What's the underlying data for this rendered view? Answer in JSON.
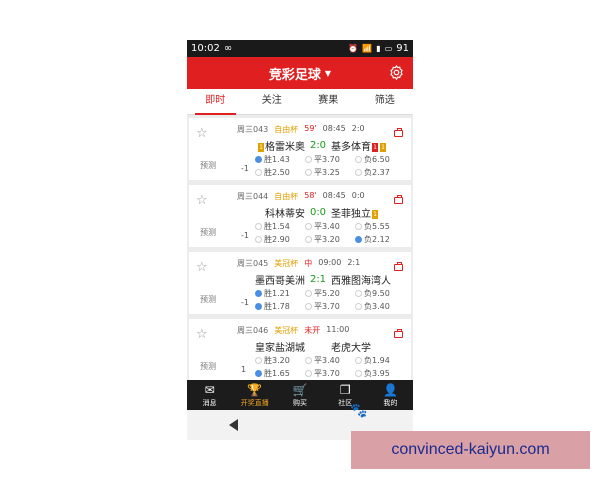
{
  "status_bar": {
    "time": "10:02",
    "infinity": "∞",
    "battery": "91"
  },
  "header": {
    "title": "竞彩足球"
  },
  "tabs": [
    {
      "label": "即时",
      "active": true
    },
    {
      "label": "关注",
      "active": false
    },
    {
      "label": "赛果",
      "active": false
    },
    {
      "label": "筛选",
      "active": false
    }
  ],
  "predict_label": "预测",
  "matches": [
    {
      "no": "周三043",
      "league": "自由杯",
      "league_color": "#e0a000",
      "minute": "59'",
      "time": "08:45",
      "half": "2:0",
      "home": "格雷米奥",
      "score": "2:0",
      "away": "基多体育",
      "home_badges": [
        {
          "t": "1",
          "c": "y"
        }
      ],
      "away_badges": [
        {
          "t": "1",
          "c": "r"
        },
        {
          "t": "1",
          "c": "y"
        }
      ],
      "handicap": "",
      "odds1": [
        "胜1.43",
        "平3.70",
        "负6.50"
      ],
      "sel1": 0,
      "handicap2": "-1",
      "odds2": [
        "胜2.50",
        "平3.25",
        "负2.37"
      ],
      "sel2": -1
    },
    {
      "no": "周三044",
      "league": "自由杯",
      "league_color": "#e0a000",
      "minute": "58'",
      "time": "08:45",
      "half": "0:0",
      "home": "科林蒂安",
      "score": "0:0",
      "away": "圣菲独立",
      "home_badges": [],
      "away_badges": [
        {
          "t": "1",
          "c": "y"
        }
      ],
      "odds1": [
        "胜1.54",
        "平3.40",
        "负5.55"
      ],
      "sel1": -1,
      "handicap2": "-1",
      "odds2": [
        "胜2.90",
        "平3.20",
        "负2.12"
      ],
      "sel2": 2
    },
    {
      "no": "周三045",
      "league": "美冠杯",
      "league_color": "#e0a000",
      "minute": "中",
      "time": "09:00",
      "half": "2:1",
      "home": "墨西哥美洲",
      "score": "2:1",
      "away": "西雅图海湾人",
      "home_badges": [],
      "away_badges": [],
      "odds1": [
        "胜1.21",
        "平5.20",
        "负9.50"
      ],
      "sel1": 0,
      "handicap2": "-1",
      "odds2": [
        "胜1.78",
        "平3.70",
        "负3.40"
      ],
      "sel2": 0
    },
    {
      "no": "周三046",
      "league": "美冠杯",
      "league_color": "#e0a000",
      "minute": "未开",
      "time": "11:00",
      "half": "",
      "home": "皇家盐湖城",
      "score": "",
      "away": "老虎大学",
      "home_badges": [],
      "away_badges": [],
      "odds1": [
        "胜3.20",
        "平3.40",
        "负1.94"
      ],
      "sel1": -1,
      "handicap2": "1",
      "odds2": [
        "胜1.65",
        "平3.70",
        "负3.95"
      ],
      "sel2": 0
    }
  ],
  "bottom_nav": [
    {
      "label": "消息",
      "icon": "mail-icon",
      "glyph": "✉",
      "active": false
    },
    {
      "label": "开奖直播",
      "icon": "trophy-icon",
      "glyph": "🏆",
      "active": true
    },
    {
      "label": "购买",
      "icon": "cart-icon",
      "glyph": "🛒",
      "active": false
    },
    {
      "label": "社区",
      "icon": "chat-icon",
      "glyph": "❐",
      "active": false
    },
    {
      "label": "我的",
      "icon": "user-icon",
      "glyph": "👤",
      "active": false
    }
  ],
  "watermark": {
    "text": "convinced-kaiyun.com"
  },
  "colors": {
    "brand_red": "#e02020",
    "score_green": "#1a9a1a",
    "radio_blue": "#4a90e2",
    "accent_orange": "#f5a623"
  }
}
